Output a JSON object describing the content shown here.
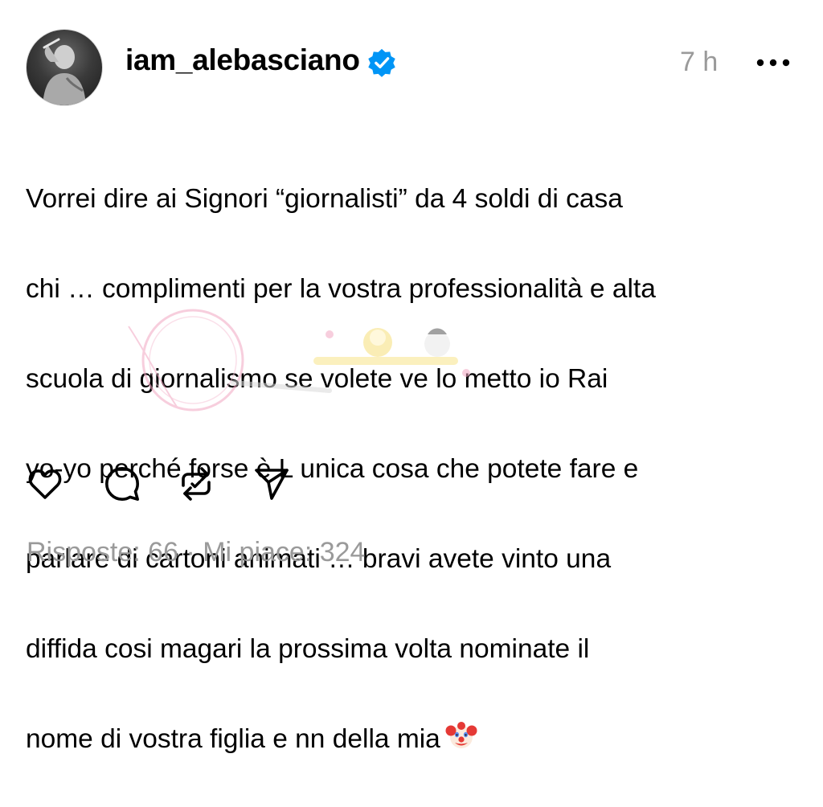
{
  "post": {
    "username": "iam_alebasciano",
    "verified": true,
    "time": "7 h",
    "caption_lines": [
      "Vorrei dire ai Signori “giornalisti” da 4 soldi di casa",
      "chi … complimenti per la vostra professionalità e alta",
      "scuola di giornalismo se volete ve lo metto io Rai",
      "yo-yo perché forse è L unica cosa che potete fare e",
      "parlare di cartoni animati … bravi avete vinto una",
      "diffida cosi magari la prossima volta nominate il",
      "nome di vostra figlia e nn della mia"
    ],
    "caption_emoji": "clown-face-emoji",
    "stats": {
      "replies_label": "Risposte: 66",
      "separator": " · ",
      "likes_label": "Mi piace: 324"
    }
  },
  "icons": {
    "verified": "verified-badge-icon",
    "more": "more-options-icon",
    "like": "heart-icon",
    "comment": "comment-bubble-icon",
    "repost": "repost-icon",
    "share": "send-icon"
  },
  "colors": {
    "text": "#000000",
    "muted": "#9a9a9a",
    "verified_blue": "#0095f6",
    "background": "#ffffff"
  }
}
